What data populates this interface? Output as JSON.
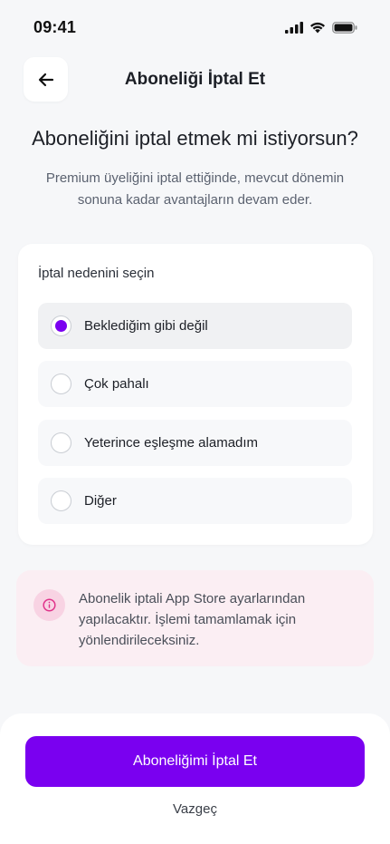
{
  "status_bar": {
    "time": "09:41",
    "icons": [
      "cellular-signal-icon",
      "wifi-icon",
      "battery-icon"
    ]
  },
  "header": {
    "title": "Aboneliği İptal Et",
    "back_icon": "arrow-left-icon"
  },
  "headline": "Aboneliğini iptal etmek mi istiyorsun?",
  "description": "Premium üyeliğini iptal ettiğinde, mevcut dönemin sonuna kadar avantajların devam eder.",
  "reasons": {
    "label": "İptal nedenini seçin",
    "options": [
      {
        "label": "Beklediğim gibi değil",
        "selected": true
      },
      {
        "label": "Çok pahalı",
        "selected": false
      },
      {
        "label": "Yeterince eşleşme alamadım",
        "selected": false
      },
      {
        "label": "Diğer",
        "selected": false
      }
    ]
  },
  "info": {
    "icon": "info-circle-icon",
    "text": "Abonelik iptali App Store ayarlarından yapılacaktır. İşlemi tamamlamak için yönlendirileceksiniz."
  },
  "actions": {
    "primary_label": "Aboneliğimi İptal Et",
    "secondary_label": "Vazgeç"
  },
  "colors": {
    "accent": "#7a00f0",
    "background": "#f6f7f9",
    "info_bg": "#fbeef3",
    "info_icon": "#e0338a"
  }
}
